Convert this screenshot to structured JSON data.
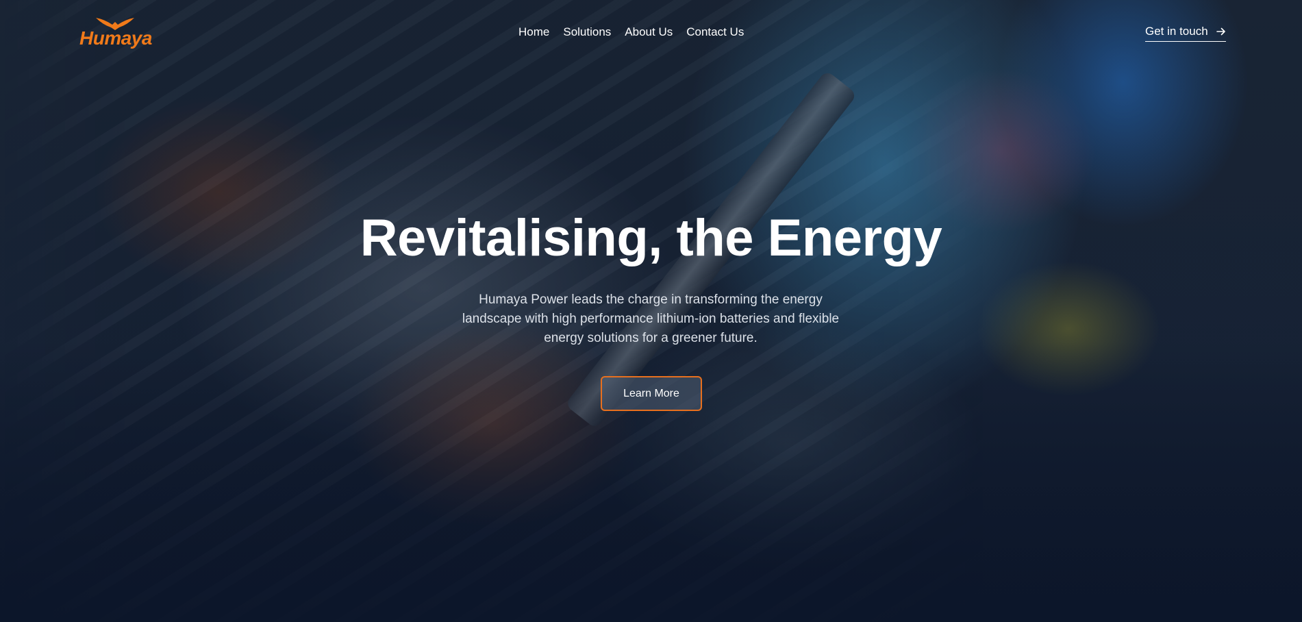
{
  "brand": {
    "logo_text": "Humaya",
    "logo_icon": "bird-logo-icon",
    "accent_color": "#f07a1a"
  },
  "nav": {
    "items": [
      {
        "label": "Home"
      },
      {
        "label": "Solutions"
      },
      {
        "label": "About Us"
      },
      {
        "label": "Contact Us"
      }
    ]
  },
  "header_cta": {
    "label": "Get in touch",
    "icon": "arrow-right-icon"
  },
  "hero": {
    "title": "Revitalising, the Energy",
    "description": "Humaya Power leads the charge in transforming the energy landscape with high performance lithium-ion batteries and flexible energy solutions for a greener future.",
    "button_label": "Learn More",
    "button_border_color": "#e8701e"
  }
}
